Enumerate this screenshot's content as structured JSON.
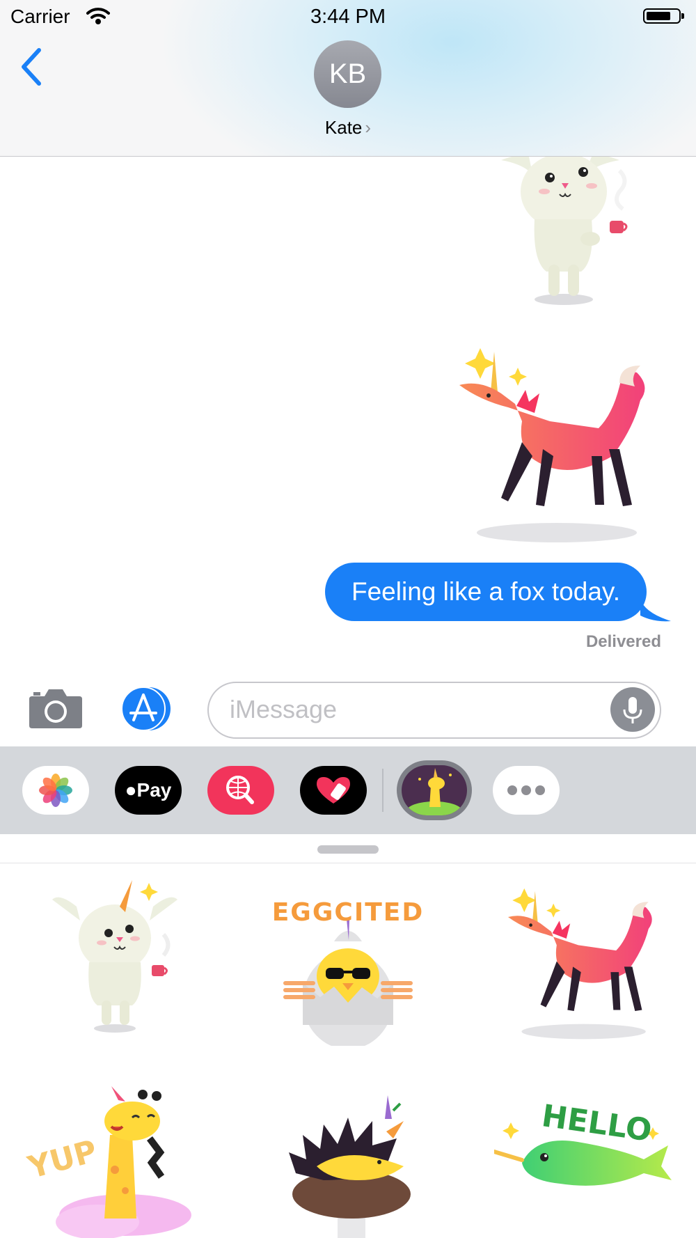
{
  "status_bar": {
    "carrier": "Carrier",
    "time": "3:44 PM"
  },
  "header": {
    "avatar_initials": "KB",
    "contact_name": "Kate",
    "contact_chevron": "›"
  },
  "messages": {
    "stickers": [
      "bunny-unicorn-sticker",
      "fox-unicorn-sticker"
    ],
    "text_bubble": "Feeling like a fox today.",
    "status": "Delivered"
  },
  "input": {
    "placeholder": "iMessage"
  },
  "app_drawer": {
    "apps": [
      "photos-app",
      "apple-pay-app",
      "search-app",
      "heart-app",
      "unicorn-stickers-app",
      "more-apps"
    ],
    "pay_label": "Pay"
  },
  "sticker_panel": {
    "stickers": [
      {
        "name": "bunny-unicorn",
        "text": ""
      },
      {
        "name": "chick-eggcited",
        "text": "EGGCITED"
      },
      {
        "name": "fox-unicorn",
        "text": ""
      },
      {
        "name": "giraffe-yup",
        "text": "YUP"
      },
      {
        "name": "hedgehog-unicorn",
        "text": ""
      },
      {
        "name": "narwhal-hello",
        "text": "HELLO"
      }
    ]
  },
  "colors": {
    "accent": "#1a80f7",
    "bubble_text": "#ffffff",
    "delivered": "#8e8e93",
    "drawer_bg": "#d4d7db"
  }
}
